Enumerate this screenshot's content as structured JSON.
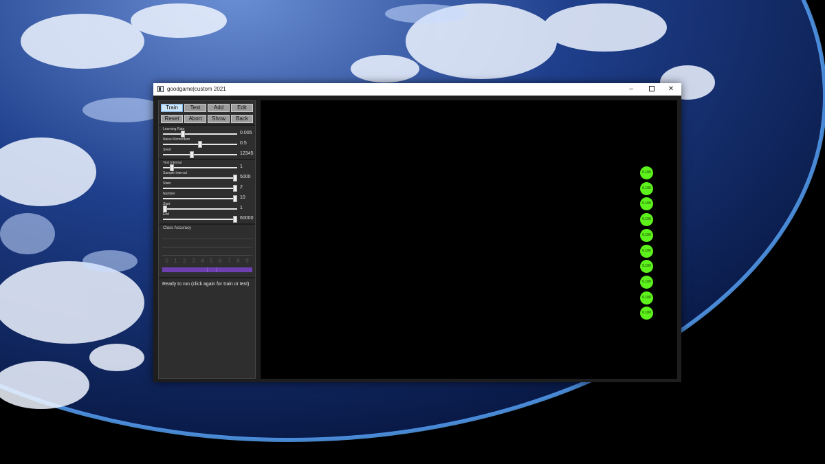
{
  "window": {
    "title": "goodgame|custom 2021"
  },
  "toolbar": {
    "buttons": [
      "Train",
      "Test",
      "Add",
      "Edit",
      "Reset",
      "Abort",
      "Show",
      "Back"
    ]
  },
  "params1": [
    {
      "label": "Learning Rate",
      "value": "0.005",
      "level": 0.25
    },
    {
      "label": "Naive Momentum",
      "value": "0.5",
      "level": 0.5
    },
    {
      "label": "Seed",
      "value": "12345",
      "level": 0.38
    }
  ],
  "params2": [
    {
      "label": "Test Interval",
      "value": "1",
      "level": 0.1
    },
    {
      "label": "Sample Interval",
      "value": "5000",
      "level": 1.0
    },
    {
      "label": "Stats",
      "value": "2",
      "level": 1.0
    },
    {
      "label": "Number",
      "value": "10",
      "level": 1.0
    },
    {
      "label": "Start",
      "value": "1",
      "level": 0.0
    },
    {
      "label": "End",
      "value": "60000",
      "level": 1.0
    }
  ],
  "accuracy": {
    "label": "Class Accuracy",
    "digits": [
      "0",
      "1",
      "2",
      "3",
      "4",
      "5",
      "6",
      "7",
      "8",
      "9"
    ]
  },
  "status": {
    "text": "Ready to run (click again for train or test)"
  },
  "output_nodes": [
    "0.100",
    "0.100",
    "0.100",
    "0.100",
    "0.100",
    "0.100",
    "0.100",
    "0.100",
    "0.100",
    "0.100"
  ],
  "colors": {
    "node": "#5ef21c",
    "accuracy_bar": "#6d3fb0",
    "active_button": "#cbe4f8"
  }
}
